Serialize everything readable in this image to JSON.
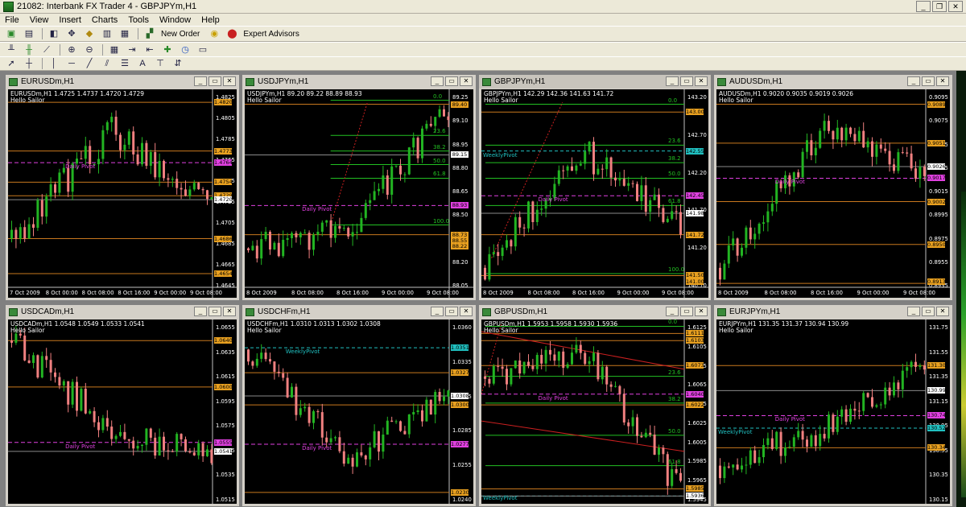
{
  "window": {
    "title": "21082: Interbank FX Trader 4 - GBPJPYm,H1",
    "controls": [
      "minimize",
      "restore",
      "close"
    ]
  },
  "menu": [
    "File",
    "View",
    "Insert",
    "Charts",
    "Tools",
    "Window",
    "Help"
  ],
  "toolbar": {
    "new_order_label": "New Order",
    "expert_advisors_label": "Expert Advisors"
  },
  "colors": {
    "up_candle": "#22b422",
    "down_candle": "#f08080",
    "pivot_line": "#e040e0",
    "level_line": "#c8781e",
    "fib_line": "#22c022",
    "weekly_pivot": "#20c0c0",
    "trend_line": "#cc2020",
    "label_box": "#e8a020",
    "pivot_box": "#e040e0"
  },
  "charts": [
    {
      "id": "eurusd",
      "title": "EURUSDm,H1",
      "info": "EURUSDm,H1  1.4725 1.4737 1.4720 1.4729",
      "hello": "Hello Sailor",
      "yticks": [
        "1.4825",
        "1.4805",
        "1.4785",
        "1.4765",
        "1.4745",
        "1.4725",
        "1.4705",
        "1.4685",
        "1.4665",
        "1.4645"
      ],
      "xticks": [
        "7 Oct 2009",
        "8 Oct 00:00",
        "8 Oct 08:00",
        "8 Oct 16:00",
        "9 Oct 00:00",
        "9 Oct 08:00"
      ],
      "pivot_label": "Daily Pivot",
      "price_boxes": [
        "1.4820",
        "1.4773",
        "1.4764",
        "1.4754",
        "1.4729",
        "1.4720",
        "1.4686",
        "1.4654"
      ]
    },
    {
      "id": "usdjpy",
      "title": "USDJPYm,H1",
      "info": "USDJPYm,H1  89.20 89.22 88.89 88.93",
      "hello": "Hello Sailor",
      "yticks": [
        "89.25",
        "89.10",
        "88.95",
        "88.80",
        "88.65",
        "88.50",
        "88.35",
        "88.20",
        "88.05"
      ],
      "xticks": [
        "8 Oct 2009",
        "8 Oct 08:00",
        "8 Oct 16:00",
        "9 Oct 00:00",
        "9 Oct 08:00"
      ],
      "fib_labels": [
        "0.0",
        "23.6",
        "38.2",
        "50.0",
        "61.8",
        "100.0"
      ],
      "pivot_label": "Daily Pivot",
      "price_boxes": [
        "89.40",
        "89.15",
        "88.93",
        "88.73",
        "88.55",
        "88.22"
      ]
    },
    {
      "id": "gbpjpy",
      "title": "GBPJPYm,H1",
      "info": "GBPJPYm,H1  142.29 142.36 141.63 141.72",
      "hello": "Hello Sailor",
      "yticks": [
        "143.20",
        "142.70",
        "142.20",
        "141.70",
        "141.20",
        "140.70"
      ],
      "xticks": [
        "8 Oct 2009",
        "8 Oct 08:00",
        "8 Oct 16:00",
        "9 Oct 00:00",
        "9 Oct 08:00"
      ],
      "fib_labels": [
        "0.0",
        "23.6",
        "38.2",
        "50.0",
        "61.8",
        "100.0"
      ],
      "weekly_pivot_label": "WeeklyPivot",
      "pivot_label": "Daily Pivot",
      "price_boxes": [
        "143.00",
        "142.55",
        "142.45",
        "141.98",
        "141.72",
        "141.50",
        "141.00"
      ]
    },
    {
      "id": "audusd",
      "title": "AUDUSDm,H1",
      "info": "AUDUSDm,H1  0.9020 0.9035 0.9019 0.9026",
      "hello": "Hello Sailor",
      "yticks": [
        "0.9095",
        "0.9075",
        "0.9055",
        "0.9035",
        "0.9015",
        "0.8995",
        "0.8975",
        "0.8955",
        "0.8935"
      ],
      "xticks": [
        "8 Oct 2009",
        "8 Oct 08:00",
        "8 Oct 16:00",
        "9 Oct 00:00",
        "9 Oct 08:00"
      ],
      "pivot_label": "Daily Pivot",
      "price_boxes": [
        "0.9089",
        "0.9051",
        "0.9026",
        "0.9017",
        "0.9002",
        "0.8950",
        "0.8913"
      ]
    },
    {
      "id": "usdcad",
      "title": "USDCADm,H1",
      "info": "USDCADm,H1  1.0548 1.0549 1.0533 1.0541",
      "hello": "Hello Sailor",
      "yticks": [
        "1.0655",
        "1.0635",
        "1.0615",
        "1.0595",
        "1.0575",
        "1.0555",
        "1.0535",
        "1.0515"
      ],
      "pivot_label": "Daily Pivot",
      "price_boxes": [
        "1.0640",
        "1.0600",
        "1.0555",
        "1.0541"
      ]
    },
    {
      "id": "usdchf",
      "title": "USDCHFm,H1",
      "info": "USDCHFm,H1  1.0310 1.0313 1.0302 1.0308",
      "hello": "Hello Sailor",
      "yticks": [
        "1.0360",
        "1.0335",
        "1.0315",
        "1.0285",
        "1.0255",
        "1.0240"
      ],
      "weekly_pivot_label": "WeeklyPivot",
      "pivot_label": "Daily Pivot",
      "price_boxes": [
        "1.0351",
        "1.0327",
        "1.0308",
        "1.0300",
        "1.0277",
        "1.0230"
      ]
    },
    {
      "id": "gbpusd",
      "title": "GBPUSDm,H1",
      "info": "GBPUSDm,H1  1.5953 1.5958 1.5930 1.5936",
      "hello": "Hello Sailor",
      "yticks": [
        "1.6125",
        "1.6105",
        "1.6085",
        "1.6065",
        "1.6045",
        "1.6025",
        "1.6005",
        "1.5985",
        "1.5965",
        "1.5945"
      ],
      "fib_labels": [
        "0.0",
        "23.6",
        "38.2",
        "50.0",
        "61.8"
      ],
      "weekly_pivot_label": "WeeklyPivot",
      "pivot_label": "Daily Pivot",
      "price_boxes": [
        "1.6111",
        "1.6103",
        "1.6073",
        "1.6040",
        "1.6022",
        "1.5985",
        "1.5946",
        "1.5936"
      ]
    },
    {
      "id": "eurjpy",
      "title": "EURJPYm,H1",
      "info": "EURJPYm,H1  131.35 131.37 130.94 130.99",
      "hello": "Hello Sailor",
      "yticks": [
        "131.75",
        "131.55",
        "131.35",
        "131.15",
        "130.95",
        "130.55",
        "130.35",
        "130.15"
      ],
      "weekly_pivot_label": "WeeklyPivot",
      "pivot_label": "Daily Pivot",
      "price_boxes": [
        "131.30",
        "130.99",
        "130.74",
        "130.52",
        "130.34"
      ]
    }
  ]
}
